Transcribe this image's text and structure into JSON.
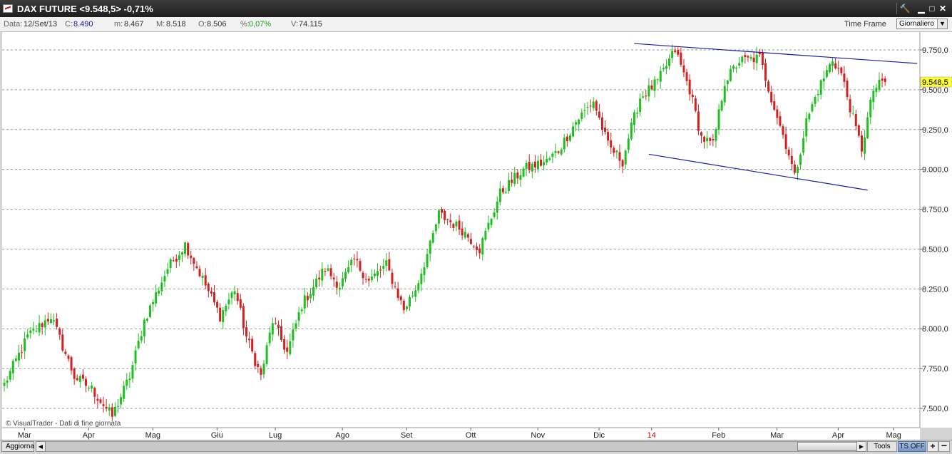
{
  "window": {
    "title": "DAX FUTURE <9.548,5> -0,71%",
    "buttons": {
      "tool": "🔨",
      "minimize": "▁",
      "maximize": "□",
      "close": "✕"
    }
  },
  "info_bar": {
    "data_label": "Data:",
    "data_value": "12/Set/13",
    "close_label": "C:",
    "close_value": "8.490",
    "min_label": "m:",
    "min_value": "8.467",
    "max_label": "M:",
    "max_value": "8.518",
    "open_label": "O:",
    "open_value": "8.506",
    "pct_label": "%:",
    "pct_value": "0,07%",
    "vol_label": "V:",
    "vol_value": "74.115",
    "time_frame_label": "Time Frame",
    "time_frame_value": "Giornaliero"
  },
  "bottom_bar": {
    "refresh_button": "Aggiorna",
    "tools_button": "Tools",
    "ts_off_button": "TS OFF",
    "zoom_in": "+",
    "zoom_out": "−",
    "scroll_left": "◀",
    "scroll_right": "▶"
  },
  "colors": {
    "up": "#1fbf1f",
    "down": "#d42020",
    "trendline": "#1a1aaa",
    "current_price_bg": "#ffff33",
    "year_label": "#cc0000"
  },
  "chart_data": {
    "type": "candlestick",
    "watermark": "© VisualTrader - Dati di fine giornata",
    "current_price": 9548.5,
    "current_price_label": "9.548,5",
    "y_axis": {
      "ticks": [
        7500,
        7750,
        8000,
        8250,
        8500,
        8750,
        9000,
        9250,
        9500,
        9750
      ],
      "tick_labels": [
        "7.500,0",
        "7.750,0",
        "8.000,0",
        "8.250,0",
        "8.500,0",
        "8.750,0",
        "9.000,0",
        "9.250,0",
        "9.500,0",
        "9.750,0"
      ],
      "range": [
        7420,
        9820
      ],
      "grid": true
    },
    "x_axis": {
      "total_sessions": 300,
      "labels": [
        {
          "label": "Mar",
          "session": 4
        },
        {
          "label": "Apr",
          "session": 26
        },
        {
          "label": "Mag",
          "session": 48
        },
        {
          "label": "Giu",
          "session": 70
        },
        {
          "label": "Lug",
          "session": 90
        },
        {
          "label": "Ago",
          "session": 113
        },
        {
          "label": "Set",
          "session": 135
        },
        {
          "label": "Ott",
          "session": 157
        },
        {
          "label": "Nov",
          "session": 180
        },
        {
          "label": "Dic",
          "session": 201
        },
        {
          "label": "14",
          "session": 219,
          "year": true
        },
        {
          "label": "Feb",
          "session": 242
        },
        {
          "label": "Mar",
          "session": 262
        },
        {
          "label": "Apr",
          "session": 283
        },
        {
          "label": "Mag",
          "session": 302
        }
      ]
    },
    "path": [
      [
        0,
        7650
      ],
      [
        8,
        7950
      ],
      [
        16,
        8080
      ],
      [
        24,
        7700
      ],
      [
        30,
        7620
      ],
      [
        37,
        7450
      ],
      [
        43,
        7700
      ],
      [
        48,
        8050
      ],
      [
        56,
        8380
      ],
      [
        62,
        8530
      ],
      [
        67,
        8350
      ],
      [
        74,
        8080
      ],
      [
        79,
        8250
      ],
      [
        83,
        7950
      ],
      [
        88,
        7700
      ],
      [
        92,
        8050
      ],
      [
        97,
        7850
      ],
      [
        102,
        8150
      ],
      [
        110,
        8380
      ],
      [
        115,
        8270
      ],
      [
        120,
        8430
      ],
      [
        125,
        8300
      ],
      [
        131,
        8400
      ],
      [
        137,
        8120
      ],
      [
        141,
        8250
      ],
      [
        146,
        8520
      ],
      [
        149,
        8720
      ],
      [
        157,
        8620
      ],
      [
        163,
        8500
      ],
      [
        170,
        8850
      ],
      [
        178,
        9000
      ],
      [
        186,
        9050
      ],
      [
        190,
        9120
      ],
      [
        196,
        9300
      ],
      [
        202,
        9430
      ],
      [
        207,
        9150
      ],
      [
        212,
        9050
      ],
      [
        214,
        9200
      ],
      [
        218,
        9450
      ],
      [
        224,
        9550
      ],
      [
        230,
        9750
      ],
      [
        235,
        9500
      ],
      [
        239,
        9200
      ],
      [
        243,
        9150
      ],
      [
        247,
        9550
      ],
      [
        252,
        9680
      ],
      [
        259,
        9700
      ],
      [
        263,
        9450
      ],
      [
        269,
        9100
      ],
      [
        271,
        8950
      ],
      [
        275,
        9300
      ],
      [
        279,
        9500
      ],
      [
        284,
        9690
      ],
      [
        287,
        9600
      ],
      [
        292,
        9250
      ],
      [
        294,
        9130
      ],
      [
        298,
        9500
      ],
      [
        302,
        9560
      ]
    ],
    "trendlines": [
      {
        "from": [
          216,
          9790
        ],
        "to": [
          313,
          9665
        ]
      },
      {
        "from": [
          221,
          9095
        ],
        "to": [
          296,
          8870
        ]
      }
    ]
  }
}
